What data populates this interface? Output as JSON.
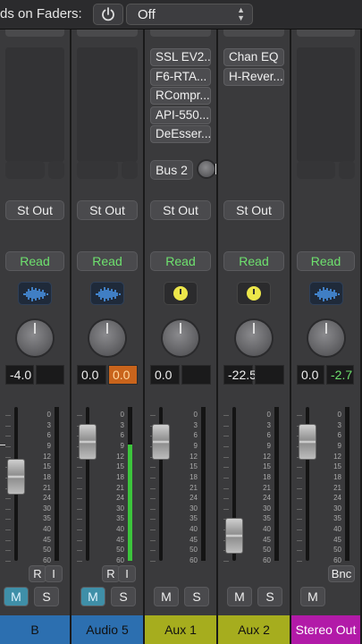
{
  "topbar": {
    "label": "ds on Faders:",
    "power_icon": "power-icon",
    "off_value": "Off",
    "select_icon": "up-down-chevron-icon"
  },
  "strips": [
    {
      "id": "b",
      "plugins": [],
      "send": null,
      "output": "St Out",
      "automation": "Read",
      "icon": "waveform-icon",
      "value_left": "-4.0",
      "value_right": "",
      "record_buttons": [
        "R",
        "I"
      ],
      "mute": "M",
      "solo": "S",
      "mute_active": true,
      "name": "B",
      "color": "#2c6fb0",
      "name_text_color": "#111111"
    },
    {
      "id": "audio5",
      "plugins": [],
      "send": null,
      "output": "St Out",
      "automation": "Read",
      "icon": "waveform-icon",
      "value_left": "0.0",
      "value_right": "0.0",
      "record_buttons": [
        "R",
        "I"
      ],
      "mute": "M",
      "solo": "S",
      "mute_active": true,
      "name": "Audio 5",
      "color": "#2c6fb0",
      "name_text_color": "#111111"
    },
    {
      "id": "aux1",
      "plugins": [
        "SSL EV2...",
        "F6-RTA...",
        "RCompr...",
        "API-550...",
        "DeEsser..."
      ],
      "send": "Bus 2",
      "output": "St Out",
      "automation": "Read",
      "icon": "yellow-knob-icon",
      "value_left": "0.0",
      "value_right": "",
      "record_buttons": [],
      "mute": "M",
      "solo": "S",
      "mute_active": false,
      "name": "Aux 1",
      "color": "#a6ad1e",
      "name_text_color": "#111111"
    },
    {
      "id": "aux2",
      "plugins": [
        "Chan EQ",
        "H-Rever..."
      ],
      "send": null,
      "output": "St Out",
      "automation": "Read",
      "icon": "yellow-knob-icon",
      "value_left": "-22.5",
      "value_right": "",
      "record_buttons": [],
      "mute": "M",
      "solo": "S",
      "mute_active": false,
      "name": "Aux 2",
      "color": "#a6ad1e",
      "name_text_color": "#111111"
    },
    {
      "id": "stereo_out",
      "plugins": [],
      "send": null,
      "output": "",
      "automation": "Read",
      "icon": "waveform-icon",
      "value_left": "0.0",
      "value_right": "-2.7",
      "record_buttons": [],
      "bounce": "Bnc",
      "mute": "M",
      "solo": "",
      "mute_active": false,
      "name": "Stereo Out",
      "color": "#b21aa8",
      "name_text_color": "#ffffff"
    }
  ],
  "fader_scale": [
    "0",
    "3",
    "6",
    "9",
    "12",
    "15",
    "18",
    "21",
    "24",
    "30",
    "35",
    "40",
    "45",
    "50",
    "60"
  ],
  "fader_levels_db": {
    "b": -19,
    "audio5": -9,
    "aux1": -9,
    "aux2": -45,
    "stereo_out": -9
  },
  "colors": {
    "read_green": "#6ee16e",
    "clip_orange": "#c9641c",
    "mute_blue": "#3f8fa8"
  }
}
